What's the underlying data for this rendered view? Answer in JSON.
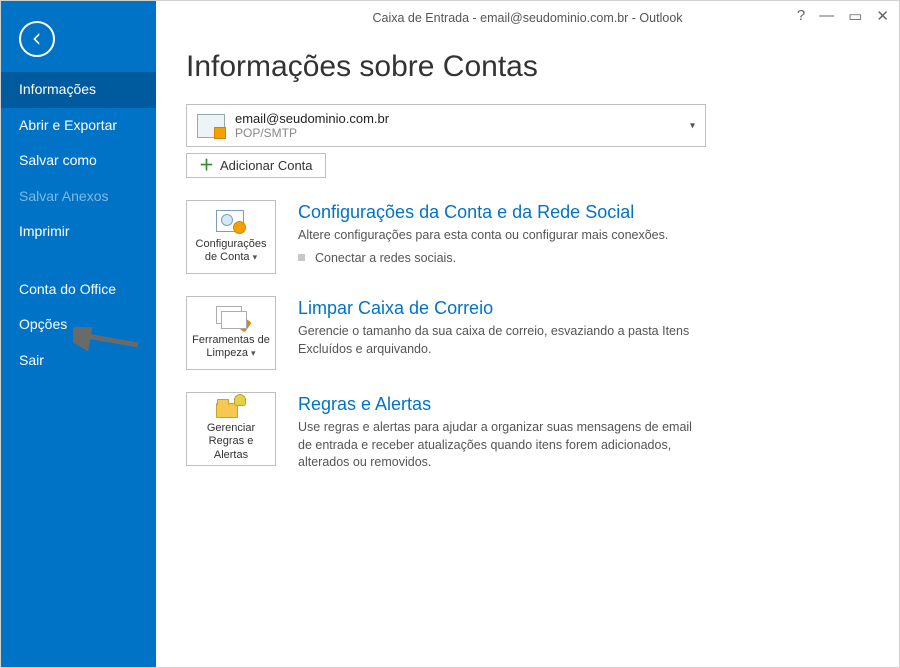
{
  "window": {
    "title": "Caixa de Entrada - email@seudominio.com.br - Outlook"
  },
  "sidebar": {
    "items": [
      {
        "label": "Informações"
      },
      {
        "label": "Abrir e Exportar"
      },
      {
        "label": "Salvar como"
      },
      {
        "label": "Salvar Anexos"
      },
      {
        "label": "Imprimir"
      }
    ],
    "bottom_items": [
      {
        "label": "Conta do Office"
      },
      {
        "label": "Opções"
      },
      {
        "label": "Sair"
      }
    ]
  },
  "page": {
    "heading": "Informações sobre Contas"
  },
  "account": {
    "email": "email@seudominio.com.br",
    "type": "POP/SMTP",
    "add_label": "Adicionar Conta"
  },
  "sections": {
    "config": {
      "card_label": "Configurações de Conta",
      "title": "Configurações da Conta e da Rede Social",
      "desc": "Altere configurações para esta conta ou configurar mais conexões.",
      "bullet": "Conectar a redes sociais."
    },
    "cleanup": {
      "card_label": "Ferramentas de Limpeza",
      "title": "Limpar Caixa de Correio",
      "desc": "Gerencie o tamanho da sua caixa de correio, esvaziando a pasta Itens Excluídos e arquivando."
    },
    "rules": {
      "card_label": "Gerenciar Regras e Alertas",
      "title": "Regras e Alertas",
      "desc": "Use regras e alertas para ajudar a organizar suas mensagens de email de entrada e receber atualizações quando itens forem adicionados, alterados ou removidos."
    }
  }
}
